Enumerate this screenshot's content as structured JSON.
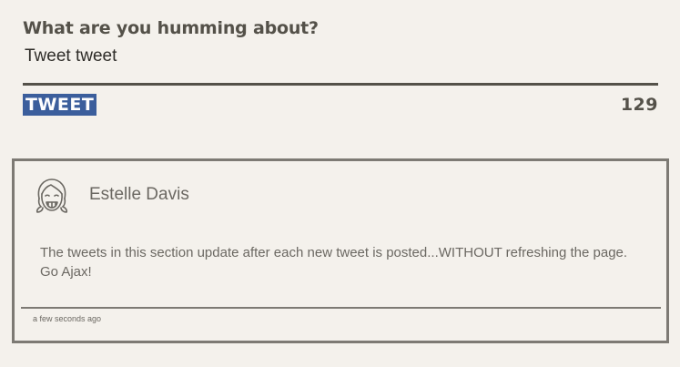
{
  "compose": {
    "label": "What are you humming about?",
    "value": "Tweet tweet",
    "button_label": "TWEET",
    "char_count": "129"
  },
  "tweet": {
    "avatar_icon": "girl-face-icon",
    "author": "Estelle Davis",
    "body": "The tweets in this section update after each new tweet is posted...WITHOUT refreshing the page. Go Ajax!",
    "timestamp": "a few seconds ago"
  },
  "colors": {
    "background": "#f4f1ec",
    "text": "#545149",
    "button": "#3b5e9c",
    "border": "#7d7a74"
  }
}
